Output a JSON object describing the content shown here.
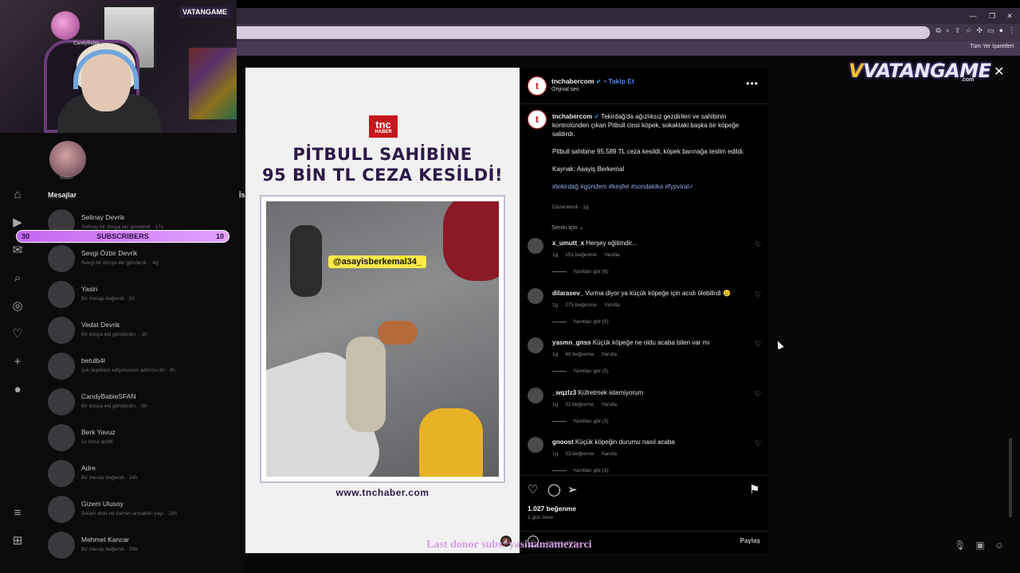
{
  "webcam": {
    "handle": "CandyBabie",
    "stream_logo": "VATANGAME"
  },
  "browser": {
    "bookmark_folder": "Tüm Yer İşaretleri"
  },
  "left_panel": {
    "notes_label": "Notun",
    "section_title": "Mesajlar",
    "section_title_right": "İs",
    "subscribers": {
      "label": "SUBSCRIBERS",
      "left": "30",
      "right": "10"
    },
    "messages": [
      {
        "name": "Selinay Devrik",
        "sub": "Selinay bir dosya eki gönderdi · 17s"
      },
      {
        "name": "Sevgi Özbir Devrik",
        "sub": "Sevgi bir dosya eki gönderdi. · 4g"
      },
      {
        "name": "Yasin",
        "sub": "Bir mesajı beğendi · 1h"
      },
      {
        "name": "Vedat Devrik",
        "sub": "Bir dosya eki gönderdin. · 1h"
      },
      {
        "name": "betulb4l",
        "sub": "çok teşekkür ediyoruuum admınııı30 · 4h"
      },
      {
        "name": "CandyBabieSFAN",
        "sub": "Bir dosya eki gönderdin. · 6h"
      },
      {
        "name": "Berk Yavuz",
        "sub": "1s önce aktifti"
      },
      {
        "name": "Adre",
        "sub": "Bir mesajı beğendi · 14h"
      },
      {
        "name": "Gizem Ulusoy",
        "sub": "Selam abla ne zaman arıcaktın yayı · 15h"
      },
      {
        "name": "Mehmet Kancar",
        "sub": "Bir mesajı beğendi · 26h"
      }
    ]
  },
  "post": {
    "media": {
      "logo_top": "tnc",
      "logo_bottom": "HABER",
      "headline_line1": "PİTBULL SAHİBİNE",
      "headline_line2": "95 BİN TL CEZA KESİLDİ!",
      "tag": "@asayisberkemal34_",
      "url": "www.tnchaber.com"
    },
    "author": "tnchabercom",
    "follow_label": "Takip Et",
    "audio": "Orijinal ses",
    "caption_p1": "Tekirdağ'da ağızlıksız gezdirilen ve sahibinin kontrolünden çıkan Pitbull cinsi köpek, sokaktaki başka bir köpeğe saldırdı.",
    "caption_p2": "Pitbull sahibine 95.589 TL ceza kesildi, köpek barınağa teslim edildi.",
    "caption_p3": "Kaynak: Asayiş Berkemal",
    "hashtags": "#tekirdağ #gündem #keşfet #sondakika #fypviral✓",
    "edited": "Düzenlendi · 1g",
    "for_you": "Senin için ⌄",
    "comments": [
      {
        "user": "x_umutt_x",
        "text": "Herşey eğitimdir...",
        "time": "1g",
        "likes": "151 beğenme",
        "reply": "Yanıtla",
        "replies": "Yanıtları gör (6)"
      },
      {
        "user": "dilarasev_",
        "text": "Vurma diyor ya küçük köpeğe için acıdı ölebilirdi 😢",
        "time": "1g",
        "likes": "275 beğenme",
        "reply": "Yanıtla",
        "replies": "Yanıtları gör (5)"
      },
      {
        "user": "yasmn_gnss",
        "text": "Küçük köpeğe ne oldu acaba bilen var mı",
        "time": "1g",
        "likes": "40 beğenme",
        "reply": "Yanıtla",
        "replies": "Yanıtları gör (5)"
      },
      {
        "user": "_wqzlz3",
        "text": "Küfretmek istemiyorum",
        "time": "1g",
        "likes": "32 beğenme",
        "reply": "Yanıtla",
        "replies": "Yanıtları gör (3)"
      },
      {
        "user": "gnoost",
        "text": "Küçük köpeğin durumu nasıl acaba",
        "time": "1g",
        "likes": "33 beğenme",
        "reply": "Yanıtla",
        "replies": "Yanıtları gör (3)"
      }
    ],
    "likes_total": "1.027 beğenme",
    "posted_ago": "1 gün önce",
    "comment_placeholder": "Yorum ekle...",
    "share_label": "Paylaş"
  },
  "overlay": {
    "brand": "VATANGAME",
    "brand_suffix": ".com",
    "donor_text": "Last donor subs: yasinamamezarci"
  },
  "colors": {
    "accent_blue": "#4f8ef7",
    "subs_bar": "#c266f0",
    "brand_red": "#c4161c"
  }
}
